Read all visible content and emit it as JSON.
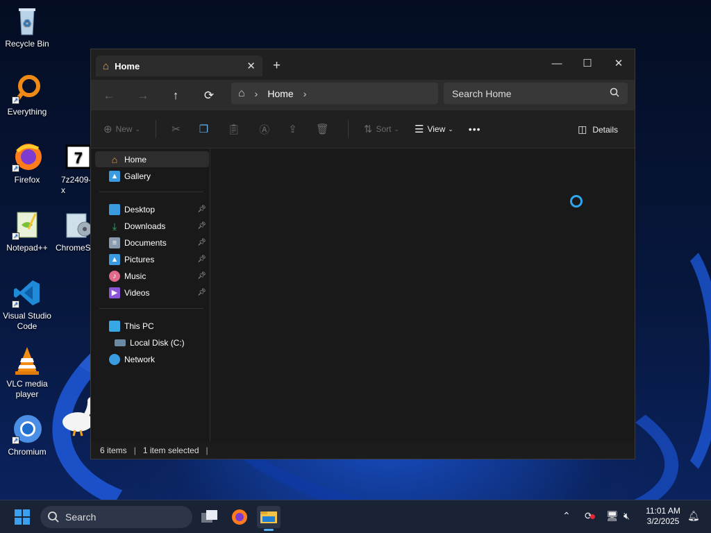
{
  "desktop": {
    "icons": [
      {
        "label": "Recycle Bin",
        "icon": "recycle-bin-icon"
      },
      {
        "label": "Everything",
        "icon": "everything-icon"
      },
      {
        "label": "Firefox",
        "icon": "firefox-icon"
      },
      {
        "label": "7z2409-x",
        "icon": "7zip-icon"
      },
      {
        "label": "Notepad++",
        "icon": "notepad-plus-plus-icon"
      },
      {
        "label": "ChromeS",
        "icon": "chrome-setup-icon"
      },
      {
        "label": "Visual Studio Code",
        "icon": "vscode-icon"
      },
      {
        "label": "VLC media player",
        "icon": "vlc-icon"
      },
      {
        "label": "Chromium",
        "icon": "chromium-icon"
      }
    ]
  },
  "window": {
    "tab_title": "Home",
    "new_tab": "+",
    "controls": {
      "minimize": "—",
      "maximize": "☐",
      "close": "✕"
    },
    "nav": {
      "back": "←",
      "forward": "→",
      "up": "↑",
      "refresh": "⟳"
    },
    "breadcrumb": {
      "root": "Home"
    },
    "search_placeholder": "Search Home",
    "toolbar": {
      "new": "New",
      "sort": "Sort",
      "view": "View",
      "more": "•••",
      "details": "Details"
    },
    "sidebar": {
      "home": "Home",
      "gallery": "Gallery",
      "quick_access": [
        {
          "label": "Desktop",
          "icon": "desktop-folder-icon",
          "color": "#3b9be0"
        },
        {
          "label": "Downloads",
          "icon": "downloads-folder-icon",
          "color": "#34b36b"
        },
        {
          "label": "Documents",
          "icon": "documents-folder-icon",
          "color": "#8a9bb0"
        },
        {
          "label": "Pictures",
          "icon": "pictures-folder-icon",
          "color": "#3b9be0"
        },
        {
          "label": "Music",
          "icon": "music-folder-icon",
          "color": "#e06a8a"
        },
        {
          "label": "Videos",
          "icon": "videos-folder-icon",
          "color": "#8a55d6"
        }
      ],
      "this_pc": "This PC",
      "local_disk": "Local Disk (C:)",
      "network": "Network"
    },
    "status": {
      "items": "6 items",
      "selected": "1 item selected"
    }
  },
  "taskbar": {
    "search_label": "Search",
    "time": "11:01 AM",
    "date": "3/2/2025"
  },
  "colors": {
    "accent": "#2fa7ef",
    "window_bg": "#191919",
    "taskbar_bg": "#1a2235"
  }
}
